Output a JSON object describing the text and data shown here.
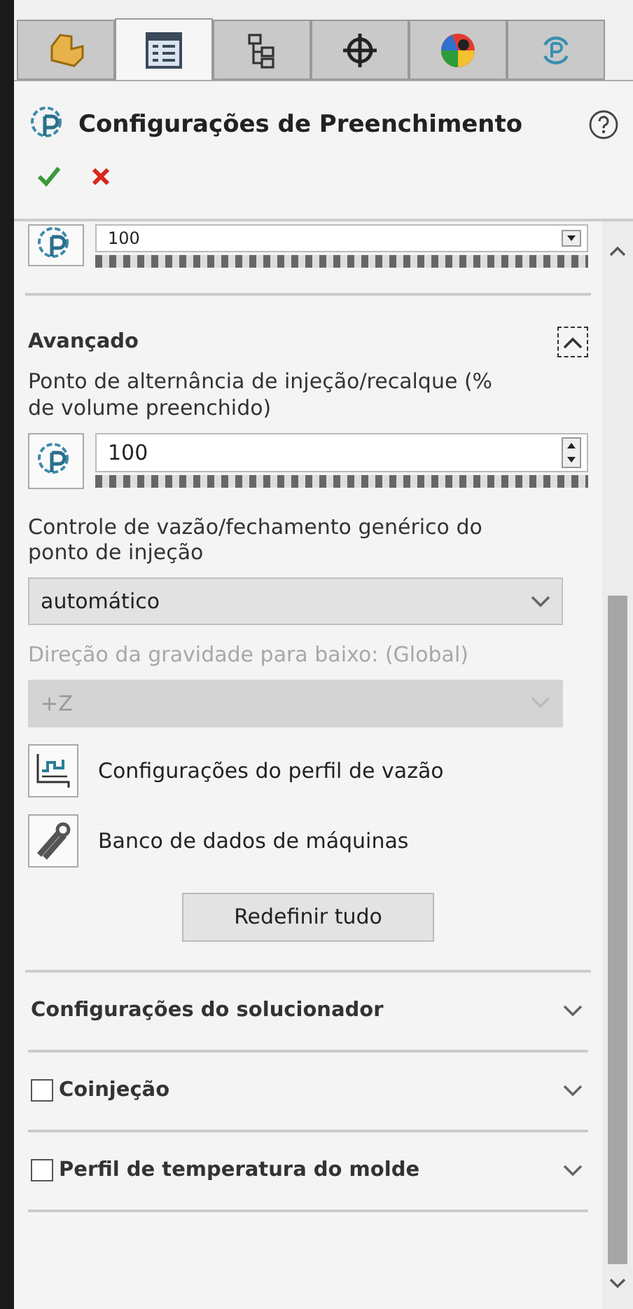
{
  "tabs": [
    {
      "kind": "part",
      "selected": false
    },
    {
      "kind": "list",
      "selected": true
    },
    {
      "kind": "tree",
      "selected": false
    },
    {
      "kind": "crosshair",
      "selected": false
    },
    {
      "kind": "ball",
      "selected": false
    },
    {
      "kind": "refresh",
      "selected": false
    }
  ],
  "panel": {
    "title": "Configurações de Preenchimento"
  },
  "top_field": {
    "value": "100"
  },
  "advanced": {
    "title": "Avançado",
    "expanded": true,
    "switch_label": "Ponto de alternância de injeção/recalque (% de volume preenchido)",
    "switch_value": "100",
    "flow_label": "Controle de vazão/fechamento genérico do ponto de injeção",
    "flow_value": "automático",
    "flow_disabled": false,
    "gravity_label": "Direção da gravidade para baixo: (Global)",
    "gravity_value": "+Z",
    "gravity_disabled": true,
    "actions": [
      {
        "kind": "chart",
        "label": "Configurações do perfil de vazão"
      },
      {
        "kind": "tools",
        "label": "Banco de dados de máquinas"
      }
    ],
    "reset_button": "Redefinir tudo"
  },
  "sections": [
    {
      "kind": "plain",
      "title": "Configurações do solucionador",
      "expanded": false
    },
    {
      "kind": "checkbox",
      "title": "Coinjeção",
      "checked": false,
      "expanded": false
    },
    {
      "kind": "checkbox",
      "title": "Perfil de temperatura do molde",
      "checked": false,
      "expanded": false
    }
  ]
}
